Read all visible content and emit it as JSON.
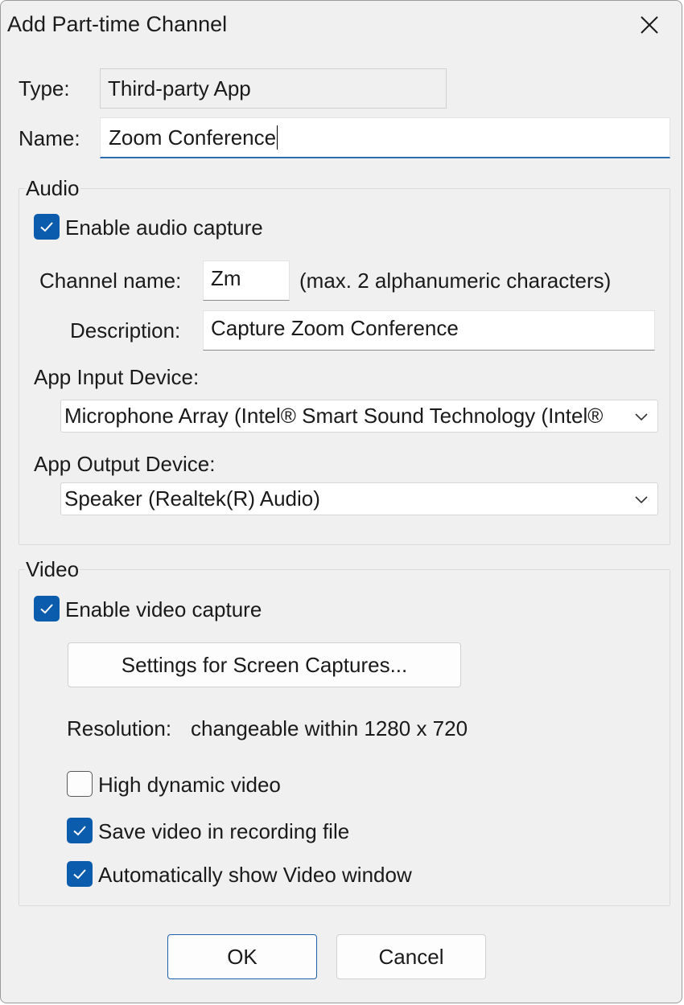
{
  "window": {
    "title": "Add Part-time Channel",
    "close_icon": "close-icon"
  },
  "type": {
    "label": "Type:",
    "value": "Third-party App"
  },
  "name": {
    "label": "Name:",
    "value": "Zoom Conference"
  },
  "audio": {
    "group_title": "Audio",
    "enable_label": "Enable audio capture",
    "enable_checked": true,
    "channel_name_label": "Channel name:",
    "channel_name_value": "Zm",
    "channel_name_hint": "(max. 2 alphanumeric characters)",
    "description_label": "Description:",
    "description_value": "Capture Zoom Conference",
    "input_device_label": "App Input Device:",
    "input_device_value": "Microphone Array (Intel® Smart Sound Technology (Intel®",
    "output_device_label": "App Output Device:",
    "output_device_value": "Speaker (Realtek(R) Audio)"
  },
  "video": {
    "group_title": "Video",
    "enable_label": "Enable video capture",
    "enable_checked": true,
    "settings_button": "Settings for Screen Captures...",
    "resolution_label": "Resolution:",
    "resolution_value": "changeable within 1280 x 720",
    "high_dynamic_label": "High dynamic video",
    "high_dynamic_checked": false,
    "save_video_label": "Save video in recording file",
    "save_video_checked": true,
    "auto_show_label": "Automatically show Video window",
    "auto_show_checked": true
  },
  "buttons": {
    "ok": "OK",
    "cancel": "Cancel"
  },
  "colors": {
    "accent": "#0b5cad",
    "dialog_bg": "#f0f0f0",
    "focus_underline": "#2b6cb0"
  }
}
